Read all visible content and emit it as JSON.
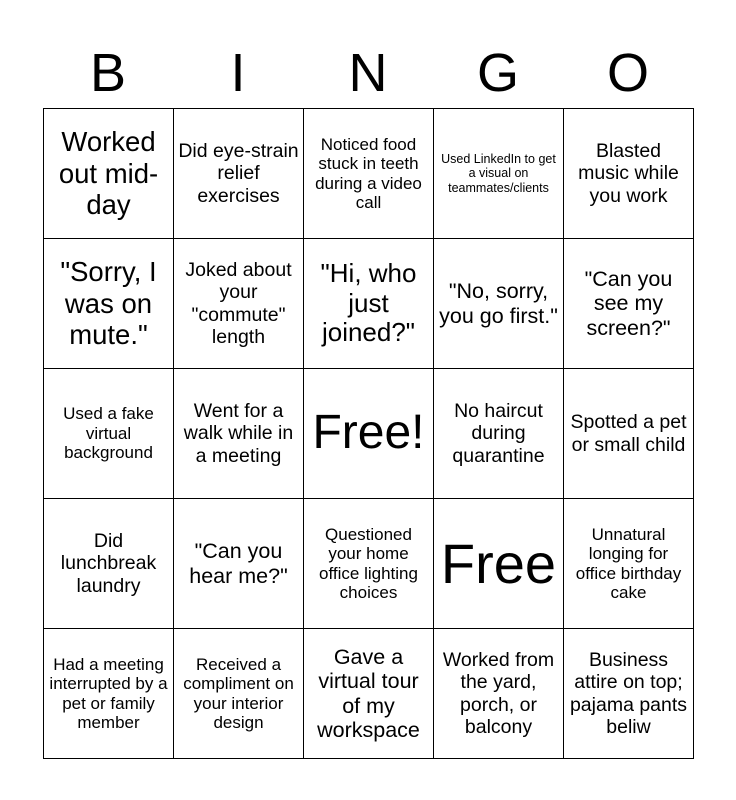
{
  "header": {
    "letters": [
      "B",
      "I",
      "N",
      "G",
      "O"
    ]
  },
  "board": {
    "rows": [
      [
        "Worked out mid-day",
        "Did eye-strain relief exercises",
        "Noticed food stuck in teeth during a video call",
        "Used LinkedIn to get a visual on teammates/clients",
        "Blasted music while you work"
      ],
      [
        "\"Sorry, I was on mute.\"",
        "Joked about your \"commute\" length",
        "\"Hi, who just joined?\"",
        "\"No, sorry, you go first.\"",
        "\"Can you see my screen?\""
      ],
      [
        "Used a fake virtual background",
        "Went for a walk while in a meeting",
        "Free!",
        "No haircut during quarantine",
        "Spotted a pet or small child"
      ],
      [
        "Did lunchbreak laundry",
        "\"Can you hear me?\"",
        "Questioned your home office lighting choices",
        "Free",
        "Unnatural longing for office birthday cake"
      ],
      [
        "Had a meeting interrupted by a pet or family member",
        "Received a compliment on your interior design",
        "Gave a virtual tour of my workspace",
        "Worked from the yard, porch, or balcony",
        "Business attire on top; pajama pants beliw"
      ]
    ]
  }
}
